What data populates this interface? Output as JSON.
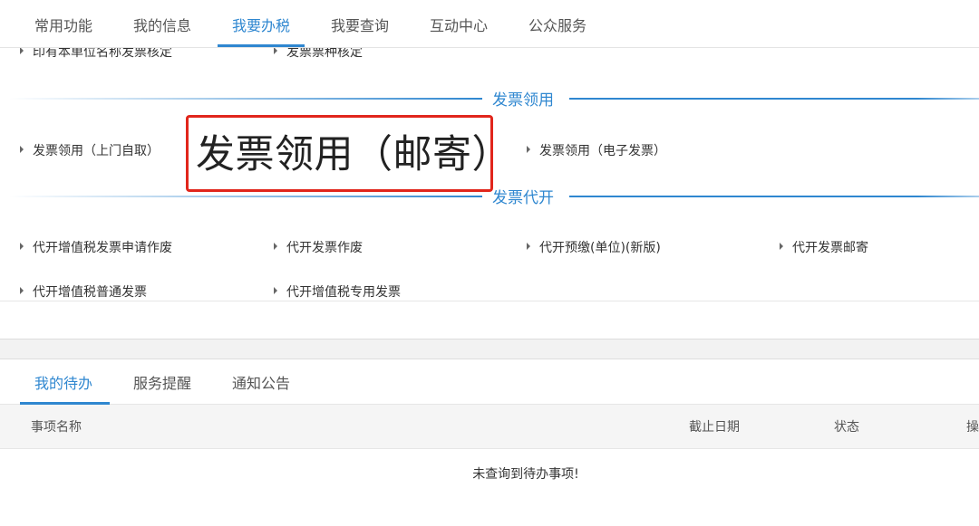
{
  "nav": {
    "tabs": [
      {
        "label": "常用功能"
      },
      {
        "label": "我的信息"
      },
      {
        "label": "我要办税"
      },
      {
        "label": "我要查询"
      },
      {
        "label": "互动中心"
      },
      {
        "label": "公众服务"
      }
    ],
    "active_index": 2
  },
  "cutoff_links": [
    "印有本单位名称发票核定",
    "发票票种核定"
  ],
  "sections": [
    {
      "title": "发票领用",
      "links": [
        "发票领用（上门自取）",
        "发票领用（邮寄）",
        "发票领用（电子发票）"
      ]
    },
    {
      "title": "发票代开",
      "links": [
        "代开增值税发票申请作废",
        "代开发票作废",
        "代开预缴(单位)(新版)",
        "代开发票邮寄",
        "代开增值税普通发票",
        "代开增值税专用发票"
      ]
    }
  ],
  "highlight": {
    "text": "发票领用（邮寄）",
    "border_color": "#e1261c"
  },
  "bottom": {
    "tabs": [
      {
        "label": "我的待办"
      },
      {
        "label": "服务提醒"
      },
      {
        "label": "通知公告"
      }
    ],
    "active_index": 0,
    "columns": [
      "事项名称",
      "截止日期",
      "状态",
      "操"
    ],
    "empty_message": "未查询到待办事项!"
  },
  "colors": {
    "accent": "#2f87d0",
    "highlight": "#e1261c"
  }
}
